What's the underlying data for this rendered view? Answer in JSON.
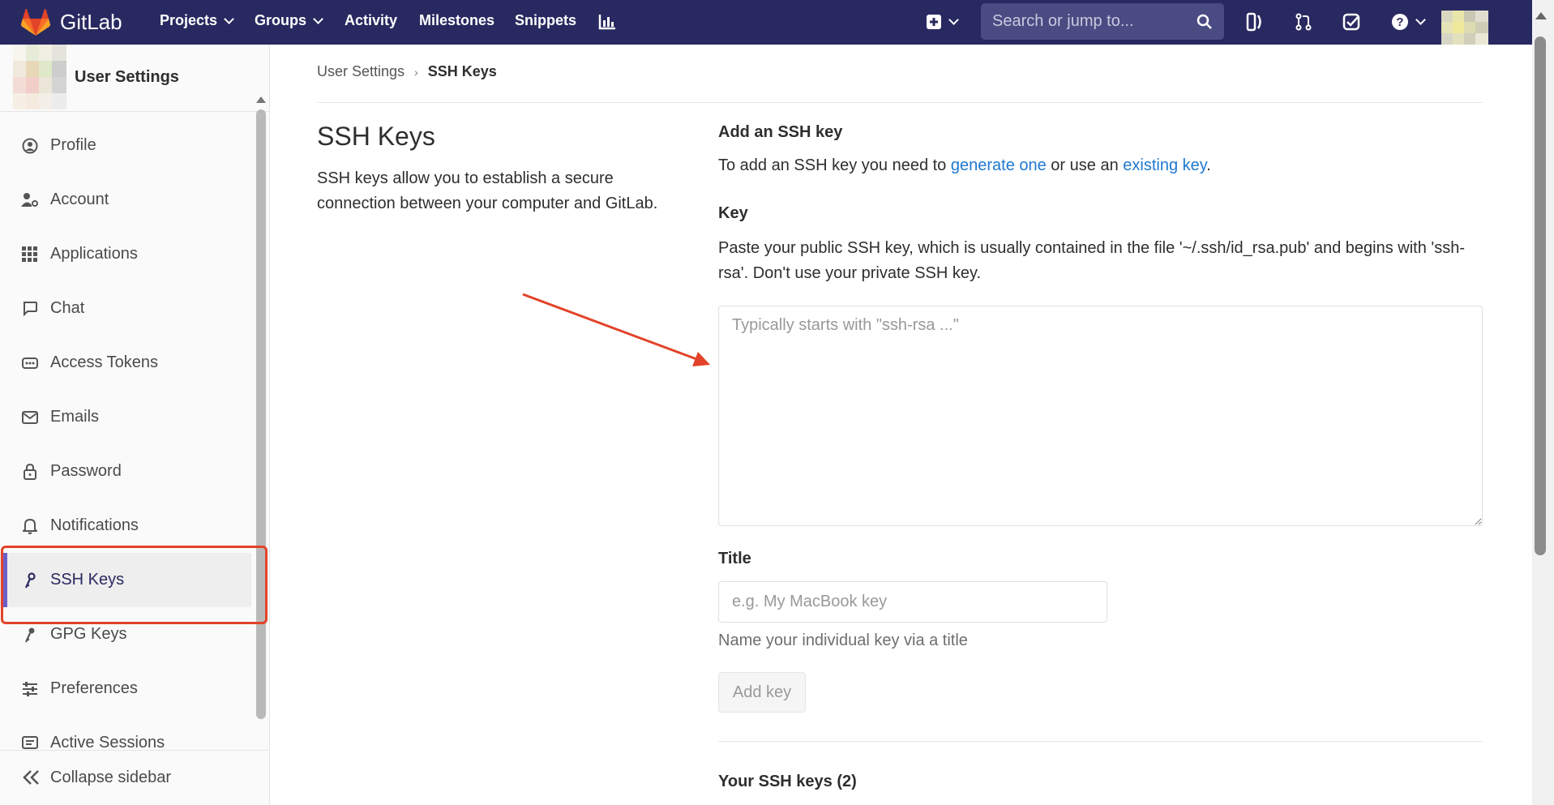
{
  "topbar": {
    "brand": "GitLab",
    "nav": [
      {
        "label": "Projects"
      },
      {
        "label": "Groups"
      },
      {
        "label": "Activity"
      },
      {
        "label": "Milestones"
      },
      {
        "label": "Snippets"
      }
    ],
    "search_placeholder": "Search or jump to...",
    "colors": {
      "background": "#292961",
      "accent": "#fc6d26"
    }
  },
  "sidebar": {
    "title": "User Settings",
    "items": [
      {
        "label": "Profile",
        "icon": "profile-icon"
      },
      {
        "label": "Account",
        "icon": "account-icon"
      },
      {
        "label": "Applications",
        "icon": "applications-icon"
      },
      {
        "label": "Chat",
        "icon": "chat-icon"
      },
      {
        "label": "Access Tokens",
        "icon": "token-icon"
      },
      {
        "label": "Emails",
        "icon": "mail-icon"
      },
      {
        "label": "Password",
        "icon": "lock-icon"
      },
      {
        "label": "Notifications",
        "icon": "bell-icon"
      },
      {
        "label": "SSH Keys",
        "icon": "key-icon",
        "active": true
      },
      {
        "label": "GPG Keys",
        "icon": "key-icon"
      },
      {
        "label": "Preferences",
        "icon": "preferences-icon"
      },
      {
        "label": "Active Sessions",
        "icon": "sessions-icon"
      }
    ],
    "collapse_label": "Collapse sidebar"
  },
  "breadcrumb": {
    "parent": "User Settings",
    "current": "SSH Keys"
  },
  "page": {
    "title": "SSH Keys",
    "description": "SSH keys allow you to establish a secure connection between your computer and GitLab."
  },
  "form": {
    "section_title": "Add an SSH key",
    "intro_prefix": "To add an SSH key you need to ",
    "intro_link1": "generate one",
    "intro_mid": " or use an ",
    "intro_link2": "existing key",
    "intro_suffix": ".",
    "key_label": "Key",
    "key_help": "Paste your public SSH key, which is usually contained in the file '~/.ssh/id_rsa.pub' and begins with 'ssh-rsa'. Don't use your private SSH key.",
    "key_placeholder": "Typically starts with \"ssh-rsa ...\"",
    "title_label": "Title",
    "title_placeholder": "e.g. My MacBook key",
    "title_help": "Name your individual key via a title",
    "submit_label": "Add key"
  },
  "keys_list": {
    "heading": "Your SSH keys (2)"
  },
  "annotation": {
    "highlight_color": "#e24329"
  }
}
